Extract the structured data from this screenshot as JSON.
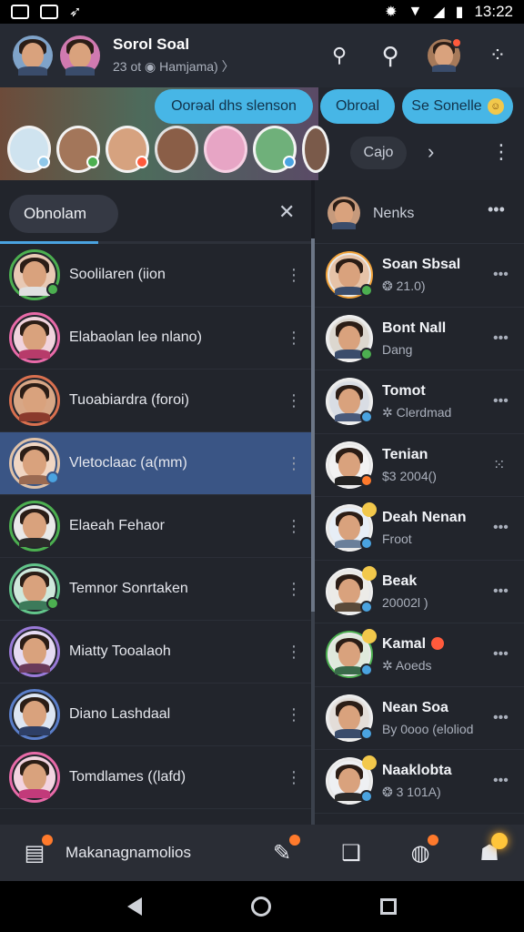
{
  "status_bar": {
    "time": "13:22"
  },
  "header": {
    "title": "Sorol Soal",
    "subtitle": "23 ot  ◉ Hamjama)  〉"
  },
  "stories": {
    "chips": [
      "Oorəal dhs slenson",
      "Obroal",
      "Se Sonelle"
    ],
    "pill_label": "Cajo"
  },
  "left_panel": {
    "search_label": "Obnolam",
    "chats": [
      {
        "name": "Soolilaren (iion"
      },
      {
        "name": "Elabaolan leə nlano)"
      },
      {
        "name": "Tuoabiardra (foroi)"
      },
      {
        "name": "Vletoclaac (a(mm)"
      },
      {
        "name": "Elaeah Fehaor"
      },
      {
        "name": "Temnor Sonrtaken"
      },
      {
        "name": "Miatty Tooalaoh"
      },
      {
        "name": "Diano Lashdaal"
      },
      {
        "name": "Tomdlames ((lafd)"
      }
    ]
  },
  "right_panel": {
    "title": "Nenks",
    "contacts": [
      {
        "name": "Soan Sbsal",
        "sub": "❂ 21.0)"
      },
      {
        "name": "Bont Nall",
        "sub": "Dang"
      },
      {
        "name": "Tomot",
        "sub": "✲ Clerdmad"
      },
      {
        "name": "Tenian",
        "sub": "$3 2004()"
      },
      {
        "name": "Deah Nenan",
        "sub": "Froot"
      },
      {
        "name": "Beak",
        "sub": "20002l   )"
      },
      {
        "name": "Kamal",
        "sub": "✲ Aoeds"
      },
      {
        "name": "Nean Soa",
        "sub": "By 0ooo (eloliod"
      },
      {
        "name": "Naaklobta",
        "sub": "❂ 3 101A)"
      }
    ]
  },
  "bottom_bar": {
    "label": "Makanagnamolios"
  },
  "colors": {
    "accent": "#4aa3e0",
    "online": "#4caf50",
    "badge": "#ff5a3c",
    "active_row": "#3a5585"
  }
}
